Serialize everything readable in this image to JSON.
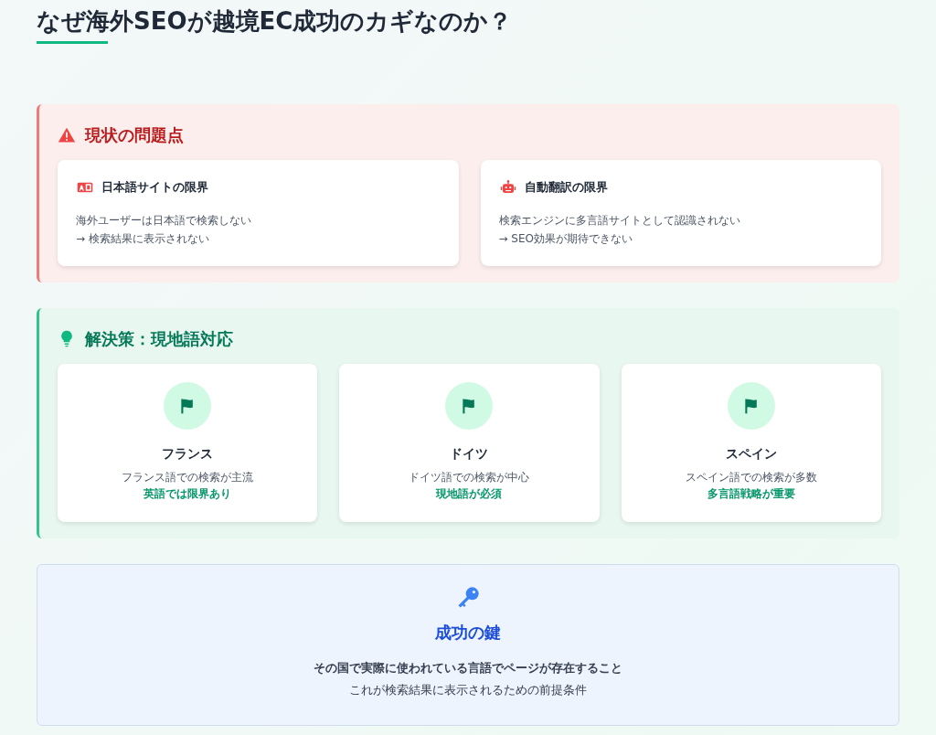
{
  "title": "なぜ海外SEOが越境EC成功のカギなのか？",
  "problem": {
    "heading": "現状の問題点",
    "cards": [
      {
        "title": "日本語サイトの限界",
        "lines": [
          "海外ユーザーは日本語で検索しない",
          "→ 検索結果に表示されない"
        ]
      },
      {
        "title": "自動翻訳の限界",
        "lines": [
          "検索エンジンに多言語サイトとして認識されない",
          "→ SEO効果が期待できない"
        ]
      }
    ]
  },
  "solution": {
    "heading": "解決策：現地語対応",
    "countries": [
      {
        "name": "フランス",
        "desc": "フランス語での検索が主流",
        "note": "英語では限界あり"
      },
      {
        "name": "ドイツ",
        "desc": "ドイツ語での検索が中心",
        "note": "現地語が必須"
      },
      {
        "name": "スペイン",
        "desc": "スペイン語での検索が多数",
        "note": "多言語戦略が重要"
      }
    ]
  },
  "key": {
    "heading": "成功の鍵",
    "lines": [
      "その国で実際に使われている言語でページが存在すること",
      "これが検索結果に表示されるための前提条件"
    ]
  }
}
